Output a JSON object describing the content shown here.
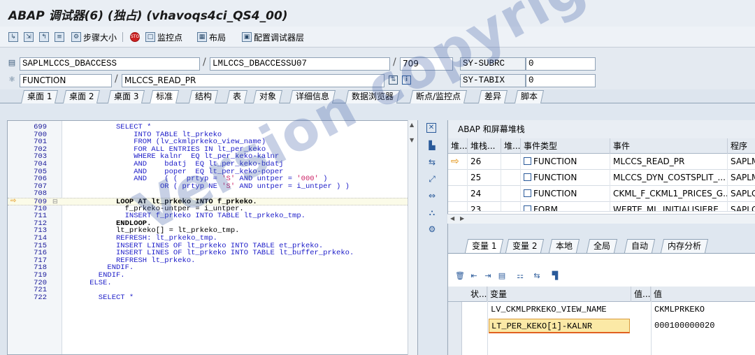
{
  "window": {
    "title": "ABAP 调试器(6) (独占) (vhavoqs4ci_QS4_00)"
  },
  "toolbar": {
    "step_size": "步骤大小",
    "watchpoint": "监控点",
    "layout": "布局",
    "configure": "配置调试器层"
  },
  "info": {
    "program": "SAPLMLCCS_DBACCESS",
    "include": "LMLCCS_DBACCESSU07",
    "line": "709",
    "event_type": "FUNCTION",
    "event": "MLCCS_READ_PR",
    "sys1_name": "SY-SUBRC",
    "sys1_value": "0",
    "sys2_name": "SY-TABIX",
    "sys2_value": "0"
  },
  "tabs": [
    "桌面 1",
    "桌面 2",
    "桌面 3",
    "标准",
    "结构",
    "表",
    "对象",
    "详细信息",
    "数据浏览器",
    "断点/监控点",
    "差异",
    "脚本"
  ],
  "code_lines": [
    {
      "n": "699",
      "t": "SELECT *",
      "i": 10,
      "k": "kw"
    },
    {
      "n": "700",
      "t": "INTO TABLE lt_prkeko",
      "i": 14,
      "k": "kw"
    },
    {
      "n": "701",
      "t": "FROM (lv_ckmlprkeko_view_name)",
      "i": 14,
      "k": "kw"
    },
    {
      "n": "702",
      "t": "FOR ALL ENTRIES IN lt_per_keko",
      "i": 14,
      "k": "kw"
    },
    {
      "n": "703",
      "t": "WHERE kalnr  EQ lt_per_keko-kalnr",
      "i": 14,
      "k": "kw"
    },
    {
      "n": "704",
      "t": "AND    bdatj  EQ lt_per_keko-bdatj",
      "i": 14,
      "k": "kw"
    },
    {
      "n": "705",
      "t": "AND    poper  EQ lt_per_keko-poper",
      "i": 14,
      "k": "kw"
    },
    {
      "n": "706",
      "t": "AND    ( (  prtyp = 'S' AND untper = '000' )",
      "i": 14,
      "k": "kw"
    },
    {
      "n": "707",
      "t": "OR ( prtyp NE 'S' AND untper = i_untper ) )",
      "i": 20,
      "k": "kw"
    },
    {
      "n": "708",
      "t": "",
      "i": 0,
      "k": ""
    },
    {
      "n": "709",
      "t": "LOOP AT lt_prkeko INTO f_prkeko.",
      "i": 10,
      "k": "kwb"
    },
    {
      "n": "710",
      "t": "f_prkeko-untper = i_untper.",
      "i": 12,
      "k": ""
    },
    {
      "n": "711",
      "t": "INSERT f_prkeko INTO TABLE lt_prkeko_tmp.",
      "i": 12,
      "k": "kw"
    },
    {
      "n": "712",
      "t": "ENDLOOP.",
      "i": 10,
      "k": "kwb"
    },
    {
      "n": "713",
      "t": "lt_prkeko[] = lt_prkeko_tmp.",
      "i": 10,
      "k": ""
    },
    {
      "n": "714",
      "t": "REFRESH: lt_prkeko_tmp.",
      "i": 10,
      "k": "kw"
    },
    {
      "n": "715",
      "t": "INSERT LINES OF lt_prkeko INTO TABLE et_prkeko.",
      "i": 10,
      "k": "kw"
    },
    {
      "n": "716",
      "t": "INSERT LINES OF lt_prkeko INTO TABLE lt_buffer_prkeko.",
      "i": 10,
      "k": "kw"
    },
    {
      "n": "717",
      "t": "REFRESH lt_prkeko.",
      "i": 10,
      "k": "kw"
    },
    {
      "n": "718",
      "t": "ENDIF.",
      "i": 8,
      "k": "kw"
    },
    {
      "n": "719",
      "t": "ENDIF.",
      "i": 6,
      "k": "kw"
    },
    {
      "n": "720",
      "t": "ELSE.",
      "i": 4,
      "k": "kw"
    },
    {
      "n": "721",
      "t": "",
      "i": 0,
      "k": ""
    },
    {
      "n": "722",
      "t": "SELECT *",
      "i": 6,
      "k": "kw"
    }
  ],
  "stack": {
    "title": "ABAP 和屏幕堆栈",
    "headers": [
      "堆...",
      "堆栈...",
      "堆...",
      "事件类型",
      "事件",
      "程序"
    ],
    "rows": [
      {
        "marker": "⇨",
        "level": "26",
        "type": "FUNCTION",
        "event": "MLCCS_READ_PR",
        "program": "SAPLM"
      },
      {
        "marker": "",
        "level": "25",
        "type": "FUNCTION",
        "event": "MLCCS_DYN_COSTSPLIT_...",
        "program": "SAPLM"
      },
      {
        "marker": "",
        "level": "24",
        "type": "FUNCTION",
        "event": "CKML_F_CKML1_PRICES_G...",
        "program": "SAPLC"
      },
      {
        "marker": "",
        "level": "23",
        "type": "FORM",
        "event": "WERTE_ML_INITIALISIERE...",
        "program": "SAPLC"
      }
    ]
  },
  "vartabs": [
    "变量 1",
    "变量 2",
    "本地",
    "全局",
    "自动",
    "内存分析"
  ],
  "vars": {
    "headers": [
      "状...",
      "变量",
      "值...",
      "值"
    ],
    "rows": [
      {
        "name": "LV_CKMLPRKEKO_VIEW_NAME",
        "value": "CKMLPRKEKO"
      },
      {
        "name": "LT_PER_KEKO[1]-KALNR",
        "value": "000100000020"
      }
    ]
  },
  "watermark": "Version copyright"
}
